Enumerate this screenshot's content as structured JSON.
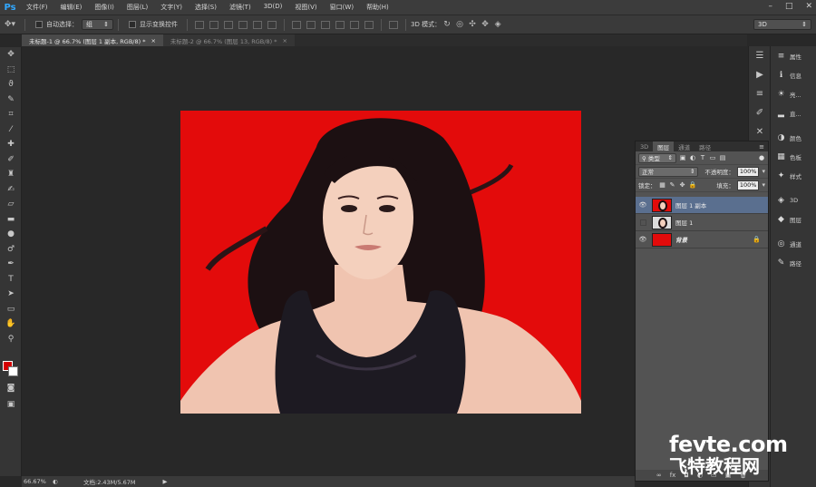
{
  "app": {
    "logo": "Ps"
  },
  "menubar": {
    "items": [
      "文件(F)",
      "编辑(E)",
      "图像(I)",
      "图层(L)",
      "文字(Y)",
      "选择(S)",
      "滤镜(T)",
      "3D(D)",
      "视图(V)",
      "窗口(W)",
      "帮助(H)"
    ]
  },
  "optionsbar": {
    "auto_select_label": "自动选择：",
    "auto_select_value": "组",
    "show_transform_label": "显示变换控件",
    "mode_3d_label": "3D 模式：",
    "workspace_value": "3D"
  },
  "documents": [
    {
      "title": "未标题-1 @ 66.7% (图层 1 副本, RGB/8) *",
      "active": true
    },
    {
      "title": "未标题-2 @ 66.7% (图层 13, RGB/8) *",
      "active": false
    }
  ],
  "statusbar": {
    "zoom": "66.67%",
    "doc_info": "文档:2.43M/5.67M"
  },
  "colors": {
    "foreground": "#d40000",
    "background": "#ffffff",
    "canvas_bg": "#e30b0b",
    "accent": "#31a8ff"
  },
  "panels_dock": {
    "items": [
      {
        "icon": "properties-icon",
        "label": "属性"
      },
      {
        "icon": "info-icon",
        "label": "信息"
      },
      {
        "icon": "brightness-icon",
        "label": "亮..."
      },
      {
        "icon": "histogram-icon",
        "label": "直..."
      },
      {
        "icon": "color-icon",
        "label": "颜色"
      },
      {
        "icon": "swatches-icon",
        "label": "色板"
      },
      {
        "icon": "styles-icon",
        "label": "样式"
      },
      {
        "icon": "cube-3d-icon",
        "label": "3D"
      },
      {
        "icon": "layers-icon",
        "label": "图层"
      },
      {
        "icon": "channels-icon",
        "label": "通道"
      },
      {
        "icon": "paths-icon",
        "label": "路径"
      }
    ]
  },
  "layers_panel": {
    "tabs": [
      "3D",
      "图层",
      "通道",
      "路径"
    ],
    "active_tab": "图层",
    "filter_label": "类型",
    "blend_mode": "正常",
    "opacity_label": "不透明度：",
    "opacity_value": "100%",
    "lock_label": "锁定：",
    "fill_label": "填充：",
    "fill_value": "100%",
    "layers": [
      {
        "name": "图层 1 副本",
        "visible": true,
        "selected": true
      },
      {
        "name": "图层 1",
        "visible": false,
        "selected": false
      },
      {
        "name": "背景",
        "visible": true,
        "selected": false,
        "locked": true
      }
    ]
  },
  "watermark": {
    "line1": "fevte.com",
    "line2": "飞特教程网"
  }
}
